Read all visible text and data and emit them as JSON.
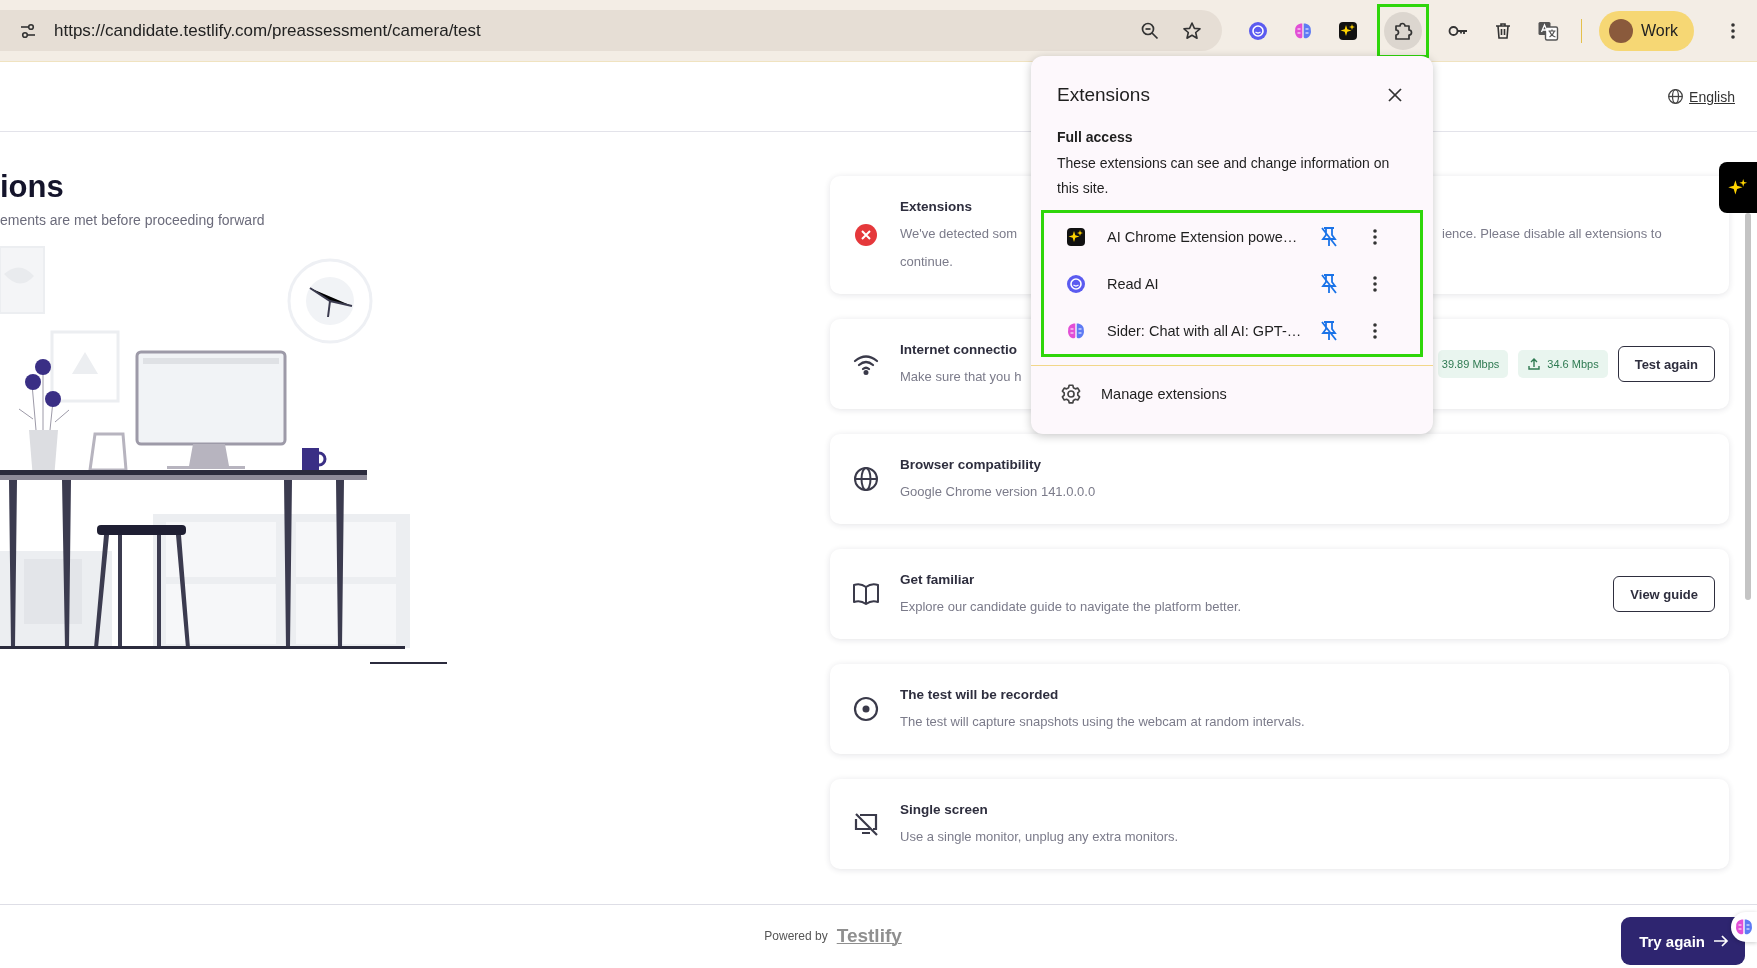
{
  "browser": {
    "url": "https://candidate.testlify.com/preassessment/camera/test",
    "extensions_button": {
      "highlighted": true
    },
    "profile": {
      "label": "Work"
    }
  },
  "header": {
    "language": "English"
  },
  "intro": {
    "title": "ions",
    "subtitle": "ements are met before proceeding forward"
  },
  "checks": [
    {
      "kind": "error",
      "title": "Extensions",
      "description_parts": [
        "We've detected som",
        "ience. Please disable all extensions to",
        "continue."
      ]
    },
    {
      "kind": "internet",
      "title": "Internet connectio",
      "description_parts": [
        "Make sure that you h"
      ],
      "speeds": [
        {
          "kind": "download",
          "value": "39.89 Mbps"
        },
        {
          "kind": "upload",
          "value": "34.6 Mbps"
        }
      ],
      "button": "Test again"
    },
    {
      "kind": "browser",
      "title": "Browser compatibility",
      "description_parts": [
        "Google Chrome version 141.0.0.0"
      ]
    },
    {
      "kind": "guide",
      "title": "Get familiar",
      "description_parts": [
        "Explore our candidate guide to navigate the platform better."
      ],
      "button": "View guide"
    },
    {
      "kind": "recording",
      "title": "The test will be recorded",
      "description_parts": [
        "The test will capture snapshots using the webcam at random intervals."
      ]
    },
    {
      "kind": "screen",
      "title": "Single screen",
      "description_parts": [
        "Use a single monitor, unplug any extra monitors."
      ]
    }
  ],
  "extensions_popup": {
    "title": "Extensions",
    "section_title": "Full access",
    "section_text": "These extensions can see and change information on this site.",
    "highlighted": true,
    "items": [
      {
        "kind": "sparkle",
        "name": "AI Chrome Extension powe…",
        "pinned": true
      },
      {
        "kind": "readai",
        "name": "Read AI",
        "pinned": true
      },
      {
        "kind": "sider",
        "name": "Sider: Chat with all AI: GPT-…",
        "pinned": true
      }
    ],
    "manage": "Manage extensions"
  },
  "footer": {
    "powered_by": "Powered by",
    "brand": "Testlify",
    "button": "Try again"
  }
}
